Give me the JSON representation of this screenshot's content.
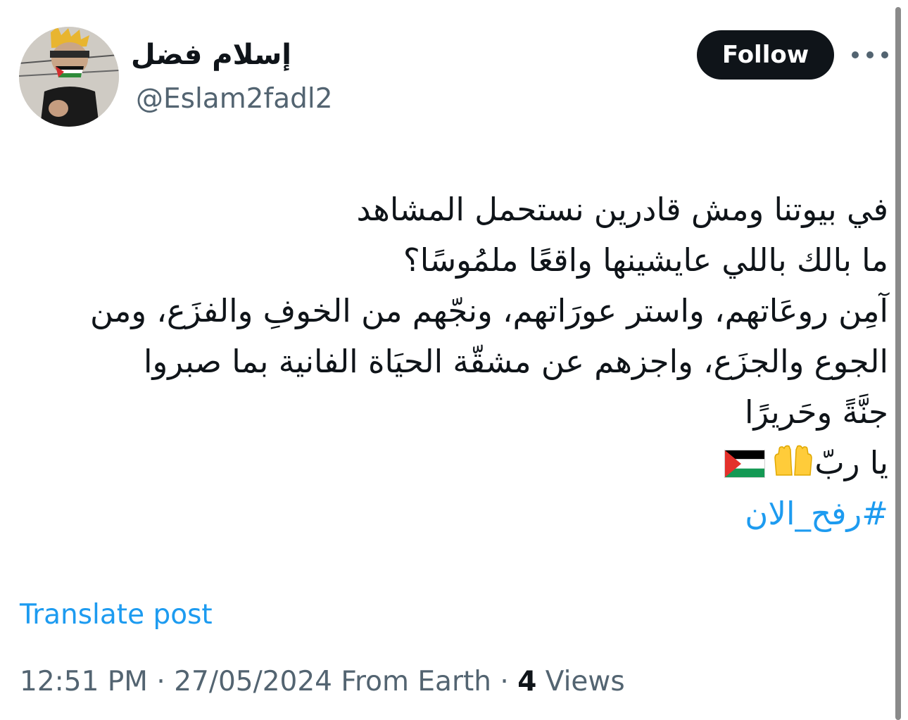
{
  "author": {
    "display_name": "إسلام فضل",
    "handle": "@Eslam2fadl2",
    "avatar_icon": "avatar-photo"
  },
  "actions": {
    "follow_label": "Follow",
    "more_icon": "more-dots-icon"
  },
  "tweet": {
    "lines": [
      "في بيوتنا ومش قادرين نستحمل المشاهد",
      "ما بالك باللي عايشينها واقعًا ملمُوسًا؟",
      "آمِن روعَاتهم، واستر عورَاتهم، ونجّهم من الخوفِ والفزَع، ومن",
      "الجوع والجزَع، واجزهم عن مشقّة الحيَاة الفانية بما صبروا",
      "جنَّةً وحَريرًا"
    ],
    "last_line_text": "يا ربّ",
    "emoji": [
      "raising-hands-icon",
      "palestine-flag-icon"
    ],
    "hashtag": "#رفح_الان"
  },
  "translate_label": "Translate post",
  "meta": {
    "time": "12:51 PM",
    "separator": "·",
    "date": "27/05/2024",
    "source": "From Earth",
    "views_count": "4",
    "views_label": "Views"
  },
  "colors": {
    "link": "#1d9bf0",
    "secondary_text": "#536471",
    "primary_text": "#0f1419",
    "follow_bg": "#0f1419"
  }
}
